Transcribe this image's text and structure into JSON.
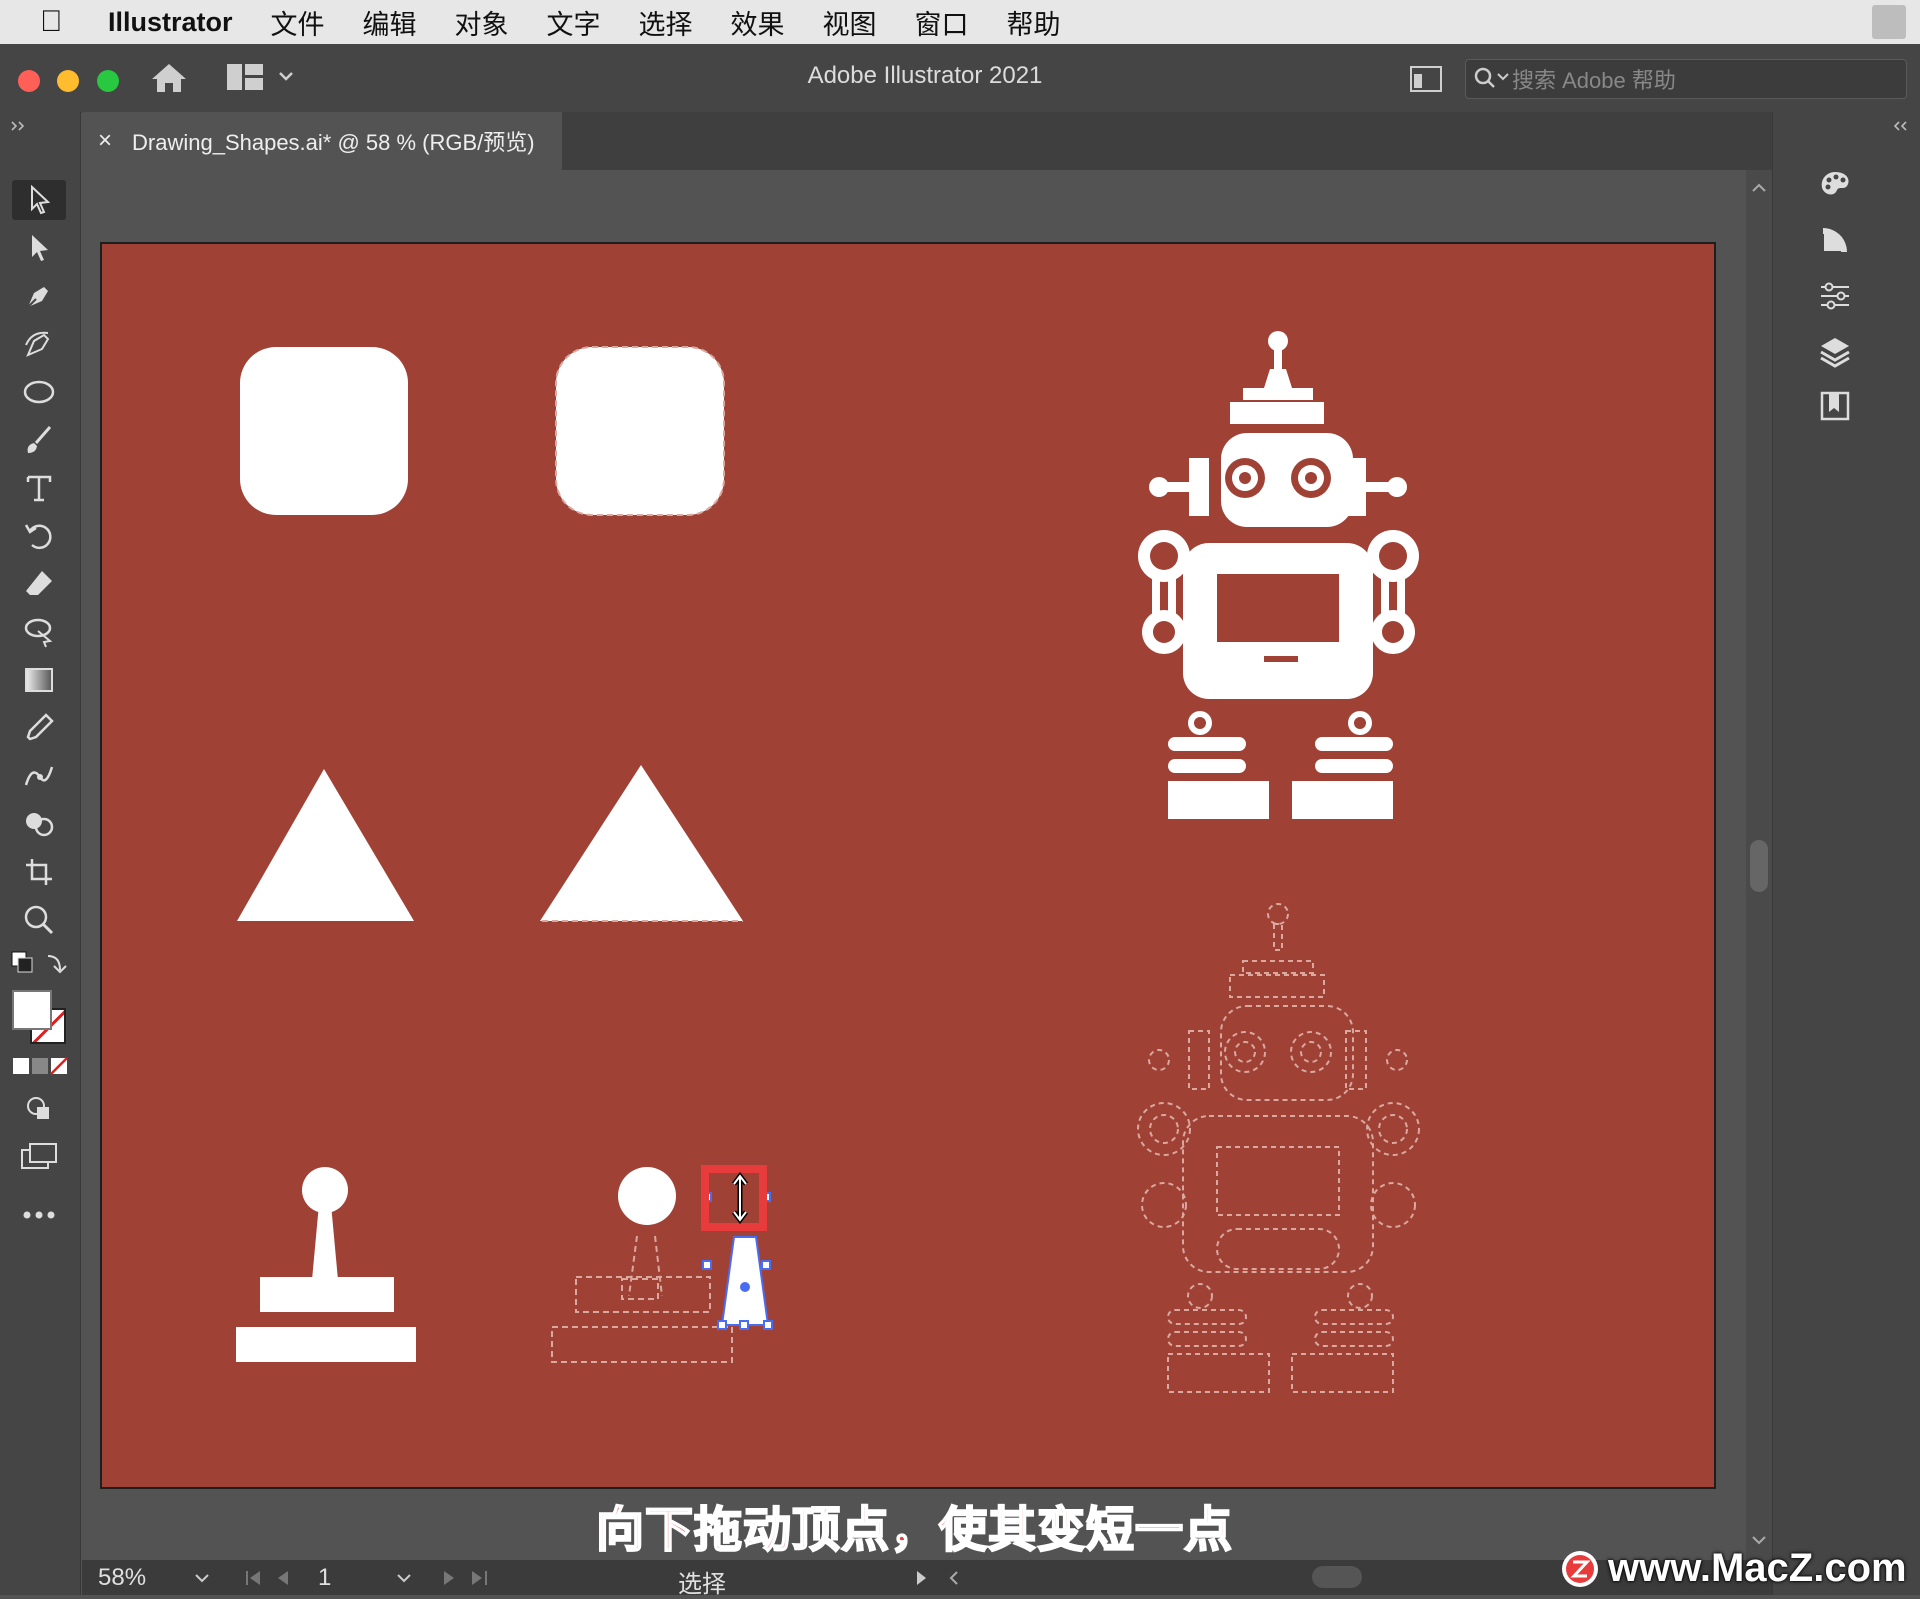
{
  "menubar": {
    "app_name": "Illustrator",
    "items": [
      "文件",
      "编辑",
      "对象",
      "文字",
      "选择",
      "效果",
      "视图",
      "窗口",
      "帮助"
    ]
  },
  "titlebar": {
    "title": "Adobe Illustrator 2021",
    "search_placeholder": "搜索 Adobe 帮助"
  },
  "tab": {
    "close": "×",
    "label": "Drawing_Shapes.ai* @ 58 % (RGB/预览)"
  },
  "statusbar": {
    "zoom": "58%",
    "page": "1",
    "tool_status": "选择"
  },
  "caption": "向下拖动顶点，使其变短一点",
  "watermark": "www.MacZ.com",
  "colors": {
    "artboard": "#a04136",
    "selection": "#4a6cf0",
    "highlight": "#e83b3b"
  },
  "icons": [
    "selection-icon",
    "direct-selection-icon",
    "pen-icon",
    "curvature-icon",
    "ellipse-icon",
    "paintbrush-icon",
    "type-icon",
    "rotate-icon",
    "eraser-icon",
    "lasso-icon",
    "gradient-icon",
    "eyedropper-icon",
    "warp-icon",
    "shape-builder-icon",
    "artboard-icon",
    "zoom-icon",
    "color-panel-icon",
    "gradient-panel-icon",
    "properties-icon",
    "layers-icon",
    "libraries-icon"
  ]
}
